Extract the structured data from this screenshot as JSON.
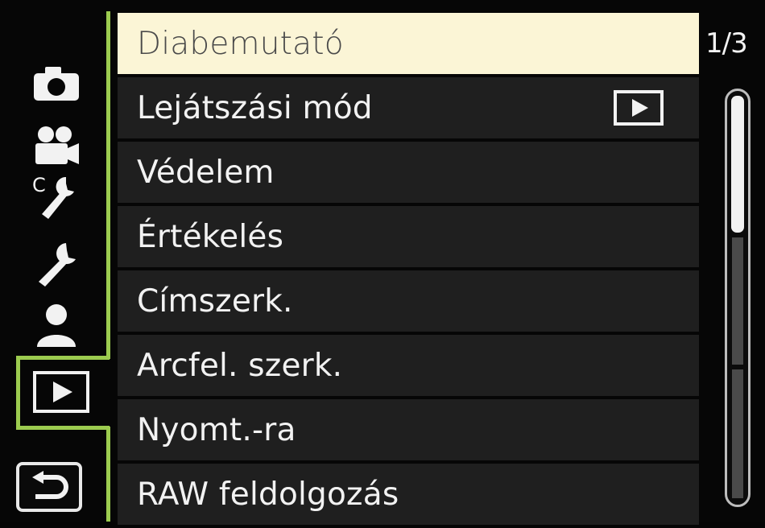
{
  "sidebar": {
    "icons": [
      "camera-icon",
      "movie-camera-icon",
      "custom-wrench-icon",
      "wrench-icon",
      "person-icon",
      "playback-icon",
      "return-icon"
    ],
    "custom_letter": "C",
    "active_tab": "playback"
  },
  "menu": {
    "items": [
      {
        "label": "Diabemutató",
        "selected": true
      },
      {
        "label": "Lejátszási mód",
        "value_icon": "playback-icon"
      },
      {
        "label": "Védelem"
      },
      {
        "label": "Értékelés"
      },
      {
        "label": "Címszerk."
      },
      {
        "label": "Arcfel. szerk."
      },
      {
        "label": "Nyomt.-ra"
      },
      {
        "label": "RAW feldolgozás"
      }
    ]
  },
  "page_indicator": "1/3",
  "scroll": {
    "page": 1,
    "pages": 3
  },
  "colors": {
    "accent_green": "#9ccb4f",
    "selected_bg": "#fbf5d6",
    "item_bg": "#1f1f1f"
  }
}
